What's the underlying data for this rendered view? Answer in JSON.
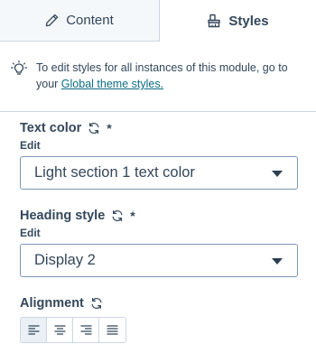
{
  "tabs": [
    {
      "label": "Content",
      "icon": "pencil-icon",
      "active": false
    },
    {
      "label": "Styles",
      "icon": "paint-brush-icon",
      "active": true
    }
  ],
  "notice": {
    "icon": "lightbulb-icon",
    "text": "To edit styles for all instances of this module, go to your ",
    "link_text": "Global theme styles."
  },
  "fields": {
    "text_color": {
      "label": "Text color",
      "required_mark": "*",
      "edit_label": "Edit",
      "value": "Light section 1 text color"
    },
    "heading_style": {
      "label": "Heading style",
      "required_mark": "*",
      "edit_label": "Edit",
      "value": "Display 2"
    },
    "alignment": {
      "label": "Alignment",
      "options": [
        {
          "icon": "align-left-icon",
          "selected": true
        },
        {
          "icon": "align-center-icon",
          "selected": false
        },
        {
          "icon": "align-right-icon",
          "selected": false
        },
        {
          "icon": "align-justify-icon",
          "selected": false
        }
      ]
    }
  },
  "colors": {
    "text": "#33475b",
    "link": "#0b6c84",
    "border": "#cbd6e2",
    "inactive_tab_bg": "#f5f8fa"
  }
}
